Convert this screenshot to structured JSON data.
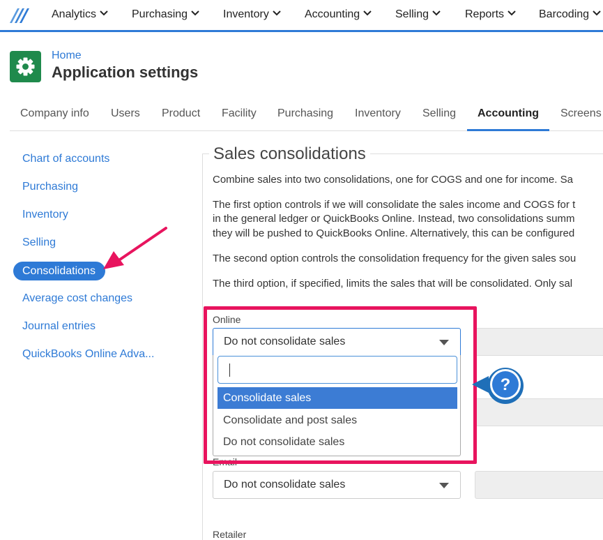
{
  "nav": {
    "items": [
      "Analytics",
      "Purchasing",
      "Inventory",
      "Accounting",
      "Selling",
      "Reports",
      "Barcoding"
    ]
  },
  "header": {
    "breadcrumb": "Home",
    "title": "Application settings"
  },
  "tabs": {
    "items": [
      "Company info",
      "Users",
      "Product",
      "Facility",
      "Purchasing",
      "Inventory",
      "Selling",
      "Accounting",
      "Screens"
    ],
    "active": "Accounting"
  },
  "sidebar": {
    "items": [
      "Chart of accounts",
      "Purchasing",
      "Inventory",
      "Selling",
      "Consolidations",
      "Average cost changes",
      "Journal entries",
      "QuickBooks Online Adva..."
    ],
    "active": "Consolidations"
  },
  "content": {
    "title": "Sales consolidations",
    "paragraphs": [
      "Combine sales into two consolidations, one for COGS and one for income. Sa",
      "The first option controls if we will consolidate the sales income and COGS for t",
      "in the general ledger or QuickBooks Online. Instead, two consolidations summ",
      "they will be pushed to QuickBooks Online. Alternatively, this can be configured",
      "The second option controls the consolidation frequency for the given sales sou",
      "The third option, if specified, limits the sales that will be consolidated. Only sal"
    ],
    "online": {
      "label": "Online",
      "value": "Do not consolidate sales",
      "search_value": "",
      "options": [
        "Consolidate sales",
        "Consolidate and post sales",
        "Do not consolidate sales"
      ],
      "highlighted_option": "Consolidate sales"
    },
    "email": {
      "label": "Email",
      "value": "Do not consolidate sales"
    },
    "retailer": {
      "label": "Retailer"
    },
    "help_icon": "?"
  },
  "colors": {
    "accent": "#2e7ad6",
    "brand_green": "#1f8a4c",
    "annotation_pink": "#e8145e",
    "option_highlight": "#3c7cd4"
  }
}
